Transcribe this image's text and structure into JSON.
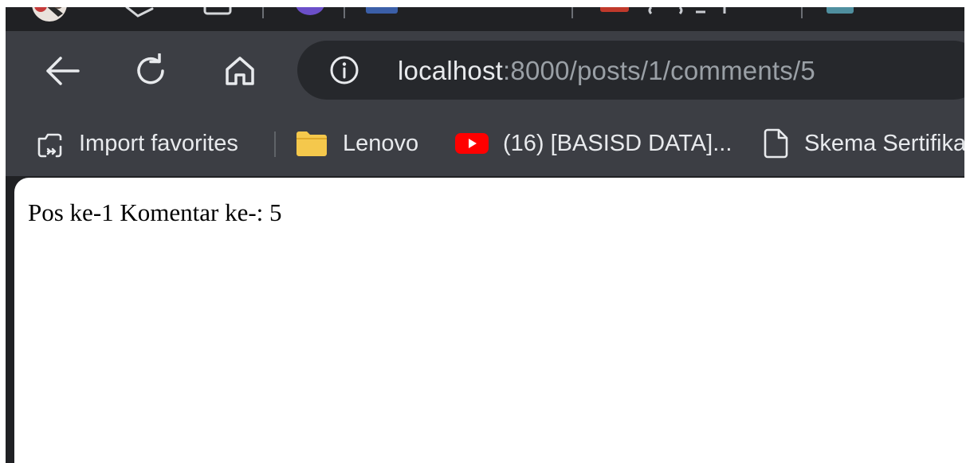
{
  "browser": {
    "url": {
      "host": "localhost",
      "rest": ":8000/posts/1/comments/5"
    },
    "icons": {
      "back": "arrow-left-icon",
      "reload": "reload-icon",
      "home": "home-icon",
      "site_info": "info-circle-icon"
    },
    "bookmarks": [
      {
        "label": "Import favorites",
        "icon": "import-favorites-icon"
      },
      {
        "label": "Lenovo",
        "icon": "folder-icon"
      },
      {
        "label": "(16) [BASISD DATA]...",
        "icon": "youtube-icon"
      },
      {
        "label": "Skema Sertifika",
        "icon": "document-icon"
      }
    ],
    "colors": {
      "frame": "#202124",
      "toolbar": "#3c3e44",
      "omnibox": "#26282c",
      "folder": "#f5c84c",
      "youtube": "#ff0000"
    }
  },
  "page": {
    "text": "Pos ke-1 Komentar ke-: 5"
  }
}
